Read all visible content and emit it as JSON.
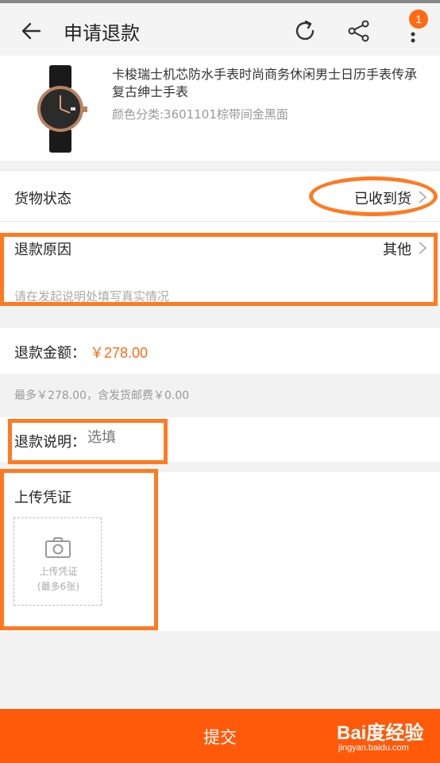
{
  "header": {
    "title": "申请退款",
    "badge_count": "1",
    "icons": [
      "back-arrow-icon",
      "refresh-icon",
      "share-icon",
      "more-vertical-icon"
    ]
  },
  "product": {
    "name": "卡梭瑞士机芯防水手表时尚商务休闲男士日历手表传承复古绅士手表",
    "spec": "颜色分类:3601101棕带间金黑面"
  },
  "goods_status": {
    "label": "货物状态",
    "value": "已收到货"
  },
  "refund_reason": {
    "label": "退款原因",
    "value": "其他",
    "hint": "请在发起说明处填写真实情况"
  },
  "refund_amount": {
    "label": "退款金额：",
    "value": "￥278.00",
    "max_note": "最多￥278.00，含发货邮费￥0.00"
  },
  "refund_desc": {
    "label": "退款说明：",
    "placeholder": "选填"
  },
  "upload": {
    "title": "上传凭证",
    "button_line1": "上传凭证",
    "button_line2": "(最多6张)"
  },
  "footer": {
    "submit_label": "提交"
  },
  "watermark": {
    "main": "Bai度经验",
    "sub": "jingyan.baidu.com"
  },
  "colors": {
    "accent": "#ff6a13",
    "annotation": "#ff7a21",
    "footer": "#ff5a0a"
  }
}
